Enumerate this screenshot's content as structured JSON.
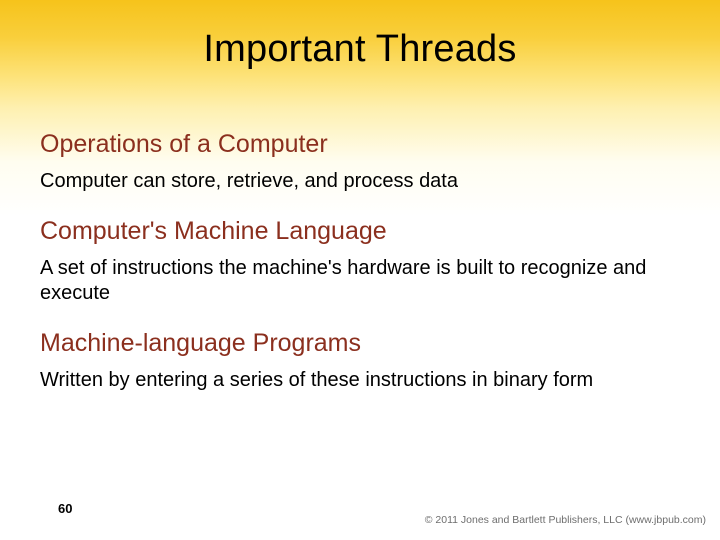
{
  "title": "Important Threads",
  "sections": [
    {
      "heading": "Operations of a Computer",
      "body": "Computer can store, retrieve, and process data"
    },
    {
      "heading": "Computer's Machine Language",
      "body": "A set of instructions the machine's hardware is built to recognize and execute"
    },
    {
      "heading": "Machine-language Programs",
      "body": "Written by entering a series of these instructions in binary form"
    }
  ],
  "page_number": "60",
  "copyright": "© 2011 Jones and Bartlett Publishers, LLC (www.jbpub.com)"
}
